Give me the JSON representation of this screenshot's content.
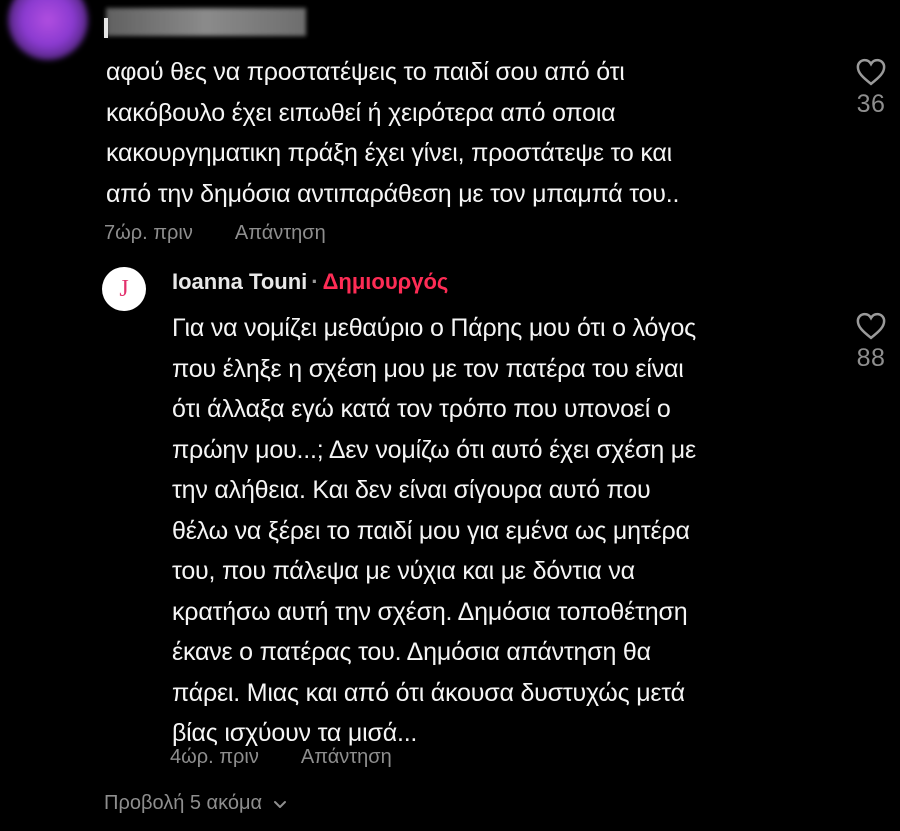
{
  "comment": {
    "lines": [
      "αφού θες να προστατέψεις το παιδί σου από ότι",
      "κακόβουλο έχει ειπωθεί ή χειρότερα από οποια",
      "κακουργηματικη πράξη έχει γίνει, προστάτεψε το και",
      "από την δημόσια αντιπαράθεση με τον μπαμπά του.."
    ],
    "time": "7ώρ. πριν",
    "reply_label": "Απάντηση",
    "likes": "36"
  },
  "reply": {
    "avatar_letter": "J",
    "username": "Ioanna Touni",
    "separator": "·",
    "badge": "Δημιουργός",
    "lines": [
      "Για να νομίζει μεθαύριο ο Πάρης μου ότι ο λόγος",
      "που έληξε η σχέση μου με τον πατέρα του είναι",
      "ότι άλλαξα εγώ κατά τον τρόπο που υπονοεί ο",
      "πρώην μου...; Δεν νομίζω ότι αυτό έχει σχέση με",
      "την αλήθεια. Και δεν είναι σίγουρα αυτό που",
      "θέλω να ξέρει το παιδί μου για εμένα ως μητέρα",
      "του, που πάλεψα με νύχια και με δόντια να",
      "κρατήσω αυτή την σχέση. Δημόσια τοποθέτηση",
      "έκανε ο πατέρας του. Δημόσια απάντηση θα",
      "πάρει. Μιας και από ότι άκουσα δυστυχώς μετά",
      "βίας ισχύουν τα μισά..."
    ],
    "time": "4ώρ. πριν",
    "reply_label": "Απάντηση",
    "likes": "88"
  },
  "view_more": {
    "label": "Προβολή 5 ακόμα",
    "icon": "chevron-down-icon"
  },
  "colors": {
    "background": "#000000",
    "text": "#f5f5f5",
    "muted": "#8e8e8e",
    "creator_badge": "#fe2c55",
    "avatar_letter": "#e2306c"
  }
}
